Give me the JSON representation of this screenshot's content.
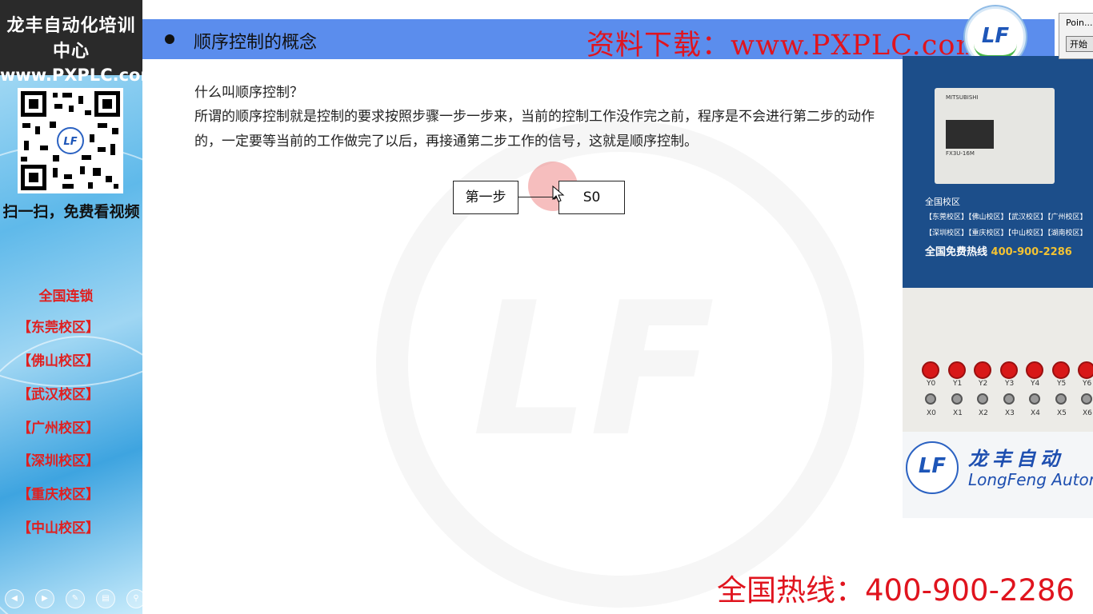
{
  "sidebar": {
    "brand_title": "龙丰自动化培训中心",
    "brand_url": "www.PXPLC.com",
    "scan_text": "扫一扫，免费看视频",
    "chain_title": "全国连锁",
    "campuses": [
      "【东莞校区】",
      "【佛山校区】",
      "【武汉校区】",
      "【广州校区】",
      "【深圳校区】",
      "【重庆校区】",
      "【中山校区】"
    ],
    "nav_controls": [
      "back-icon",
      "play-icon",
      "pen-icon",
      "slides-icon",
      "zoom-icon",
      "more-icon"
    ]
  },
  "header": {
    "title": "顺序控制的概念",
    "download": "资料下载：www.PXPLC.com",
    "logo_text": "LF"
  },
  "content": {
    "question": "什么叫顺序控制？",
    "definition": "所谓的顺序控制就是控制的要求按照步骤一步一步来，当前的控制工作没作完之前，程序是不会进行第二步的动作的，一定要等当前的工作做完了以后，再接通第二步工作的信号，这就是顺序控制。"
  },
  "diagram": {
    "step1": "第一步",
    "step2": "S0"
  },
  "photo": {
    "plc_brand": "MITSUBISHI",
    "plc_model": "FX3U-16M",
    "campus_label": "全国校区",
    "campus_row1": "【东莞校区】【佛山校区】【武汉校区】【广州校区】",
    "campus_row2": "【深圳校区】【重庆校区】【中山校区】【湖南校区】",
    "hotline_label": "全国免费热线",
    "hotline_number": "400-900-2286",
    "lamps": [
      "Y0",
      "Y1",
      "Y2",
      "Y3",
      "Y4",
      "Y5",
      "Y6"
    ],
    "switches": [
      "X0",
      "X1",
      "X2",
      "X3",
      "X4",
      "X5",
      "X6"
    ],
    "banner_logo": "LF",
    "banner_cn": "龙丰自动",
    "banner_en": "LongFeng Autom"
  },
  "popup": {
    "title": "Poin...",
    "button": "开始"
  },
  "hotline": "全国热线：400-900-2286",
  "colors": {
    "header_bg": "#5b8ded",
    "accent_red": "#e0141e",
    "logo_blue": "#1e56b8"
  }
}
